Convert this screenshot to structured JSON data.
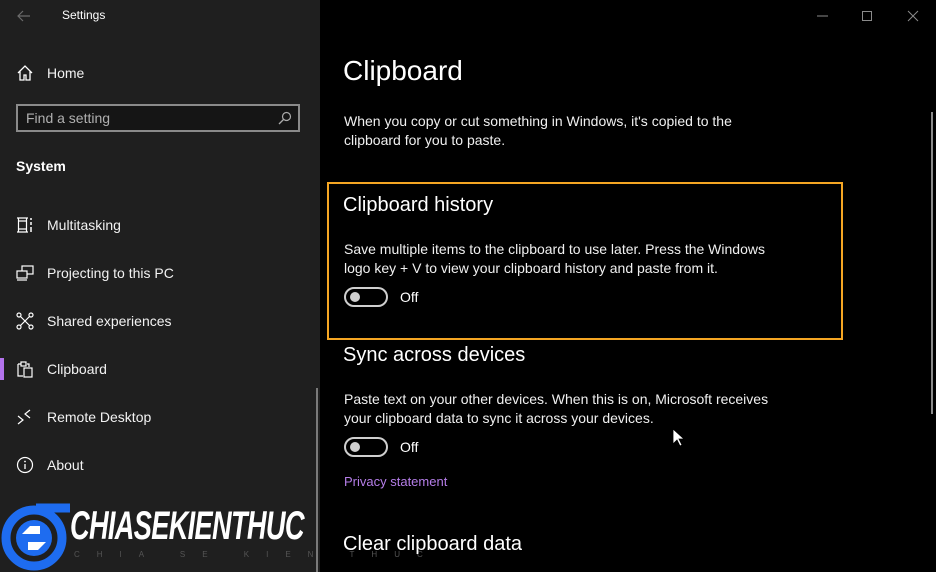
{
  "window": {
    "title": "Settings",
    "controls": [
      "minimize-icon",
      "maximize-icon",
      "close-icon"
    ]
  },
  "sidebar": {
    "home_label": "Home",
    "search": {
      "placeholder": "Find a setting",
      "value": ""
    },
    "section_title": "System",
    "items": [
      {
        "label": "Multitasking",
        "icon": "multitasking-icon",
        "selected": false
      },
      {
        "label": "Projecting to this PC",
        "icon": "projecting-icon",
        "selected": false
      },
      {
        "label": "Shared experiences",
        "icon": "shared-experiences-icon",
        "selected": false
      },
      {
        "label": "Clipboard",
        "icon": "clipboard-icon",
        "selected": true
      },
      {
        "label": "Remote Desktop",
        "icon": "remote-desktop-icon",
        "selected": false
      },
      {
        "label": "About",
        "icon": "info-icon",
        "selected": false
      }
    ],
    "accent_color": "#b373ec"
  },
  "main": {
    "title": "Clipboard",
    "intro": "When you copy or cut something in Windows, it's copied to the clipboard for you to paste.",
    "clipboard_history": {
      "heading": "Clipboard history",
      "description": "Save multiple items to the clipboard to use later. Press the Windows logo key + V to view your clipboard history and paste from it.",
      "toggle_state": "Off"
    },
    "sync": {
      "heading": "Sync across devices",
      "description": "Paste text on your other devices. When this is on, Microsoft receives your clipboard data to sync it across your devices.",
      "toggle_state": "Off",
      "link": "Privacy statement"
    },
    "clear": {
      "heading": "Clear clipboard data"
    },
    "highlight_color": "#f5a623",
    "link_color": "#b57ee8"
  },
  "watermark": {
    "brand": "CHIASEKIENTHUC",
    "tagline": "CHIA SE KIEN THUC",
    "color": "#1e6cf0"
  }
}
